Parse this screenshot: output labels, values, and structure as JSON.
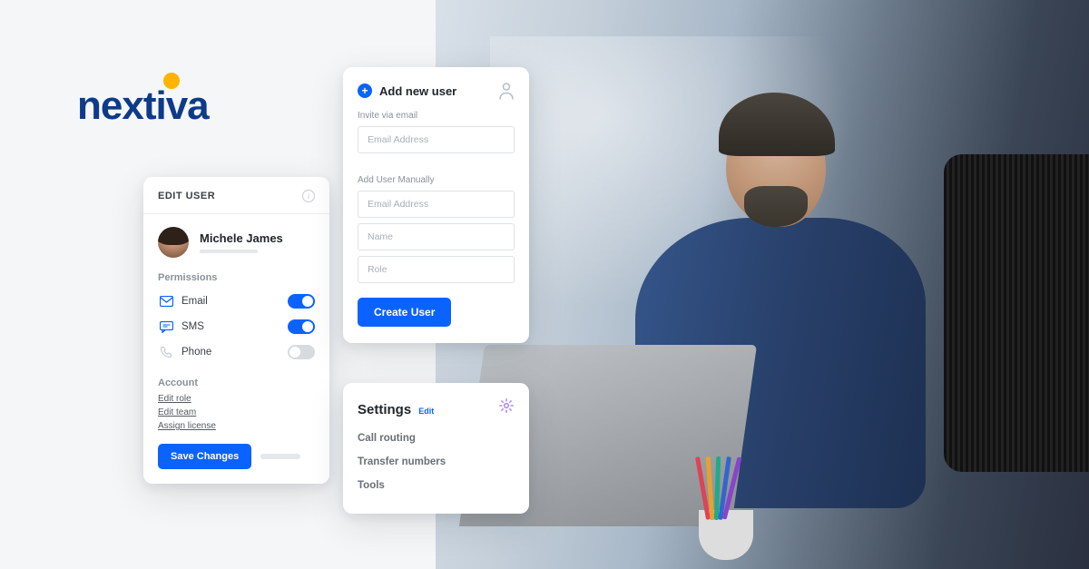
{
  "brand": {
    "name": "nextiva"
  },
  "edit_user": {
    "title": "EDIT USER",
    "user_name": "Michele James",
    "permissions_label": "Permissions",
    "perms": [
      {
        "label": "Email",
        "on": true
      },
      {
        "label": "SMS",
        "on": true
      },
      {
        "label": "Phone",
        "on": false
      }
    ],
    "account_label": "Account",
    "links": [
      "Edit role",
      "Edit team",
      "Assign license"
    ],
    "save_label": "Save Changes"
  },
  "add_user": {
    "title": "Add new user",
    "invite_label": "Invite via email",
    "invite_placeholder": "Email Address",
    "manual_label": "Add User Manually",
    "email_placeholder": "Email Address",
    "name_placeholder": "Name",
    "role_placeholder": "Role",
    "create_label": "Create User"
  },
  "settings": {
    "title": "Settings",
    "edit_label": "Edit",
    "items": [
      "Call routing",
      "Transfer numbers",
      "Tools"
    ]
  },
  "colors": {
    "primary": "#0b63ff",
    "brand_blue": "#0d3a8a",
    "brand_accent": "#ffb400"
  }
}
